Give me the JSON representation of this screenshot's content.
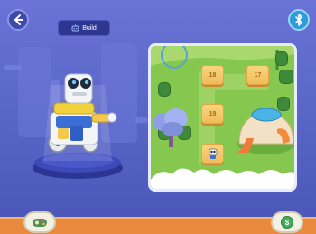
{
  "header": {
    "build_label": "Build"
  },
  "icons": {
    "back": "back-arrow-icon",
    "bluetooth": "bluetooth-icon",
    "build": "robot-build-icon",
    "bottom_left": "joystick-icon",
    "bottom_right": "coin-shop-icon"
  },
  "map": {
    "tiles": [
      "18",
      "17",
      "19"
    ]
  },
  "colors": {
    "background": "#5b67c9",
    "grass": "#7fc24a",
    "tile": "#f6c86a",
    "ribbon": "#e98a3f",
    "bluetooth": "#2f9bd9"
  }
}
